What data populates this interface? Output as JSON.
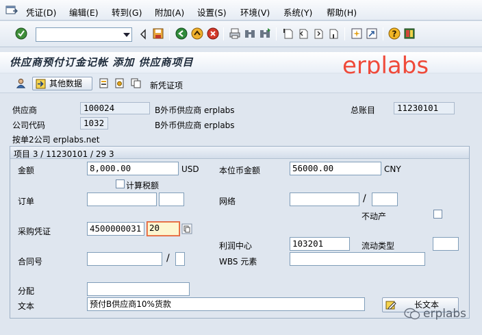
{
  "menu": {
    "items": [
      "凭证(D)",
      "编辑(E)",
      "转到(G)",
      "附加(A)",
      "设置(S)",
      "环境(V)",
      "系统(Y)",
      "帮助(H)"
    ]
  },
  "command_field": {
    "value": ""
  },
  "title": "供应商预付订金记帐 添加 供应商项目",
  "watermark": "erplabs",
  "app_toolbar": {
    "other_data_label": "其他数据",
    "new_doc_label": "新凭证项"
  },
  "header": {
    "vendor_label": "供应商",
    "vendor_value": "100024",
    "vendor_name": "B外币供应商 erplabs",
    "gl_label": "总账目",
    "gl_value": "11230101",
    "company_label": "公司代码",
    "company_value": "1032",
    "company_vendor_name": "B外币供应商 erplabs",
    "company_name": "按单2公司 erplabs.net"
  },
  "item": {
    "group_title": "项目 3 / 11230101 / 29 3",
    "amount_label": "金额",
    "amount_value": "8,000.00",
    "amount_currency": "USD",
    "local_amount_label": "本位币金额",
    "local_amount_value": "56000.00",
    "local_currency": "CNY",
    "calc_tax_label": "计算税额",
    "order_label": "订单",
    "network_label": "网络",
    "real_estate_label": "不动产",
    "po_label": "采购凭证",
    "po_value": "4500000031",
    "po_item_value": "20",
    "profit_center_label": "利润中心",
    "profit_center_value": "103201",
    "flow_type_label": "流动类型",
    "contract_label": "合同号",
    "wbs_label": "WBS 元素",
    "assignment_label": "分配",
    "text_label": "文本",
    "text_value": "预付B供应商10%货款",
    "long_text_label": "长文本",
    "separator": "/"
  },
  "footer_watermark": "erplabs"
}
